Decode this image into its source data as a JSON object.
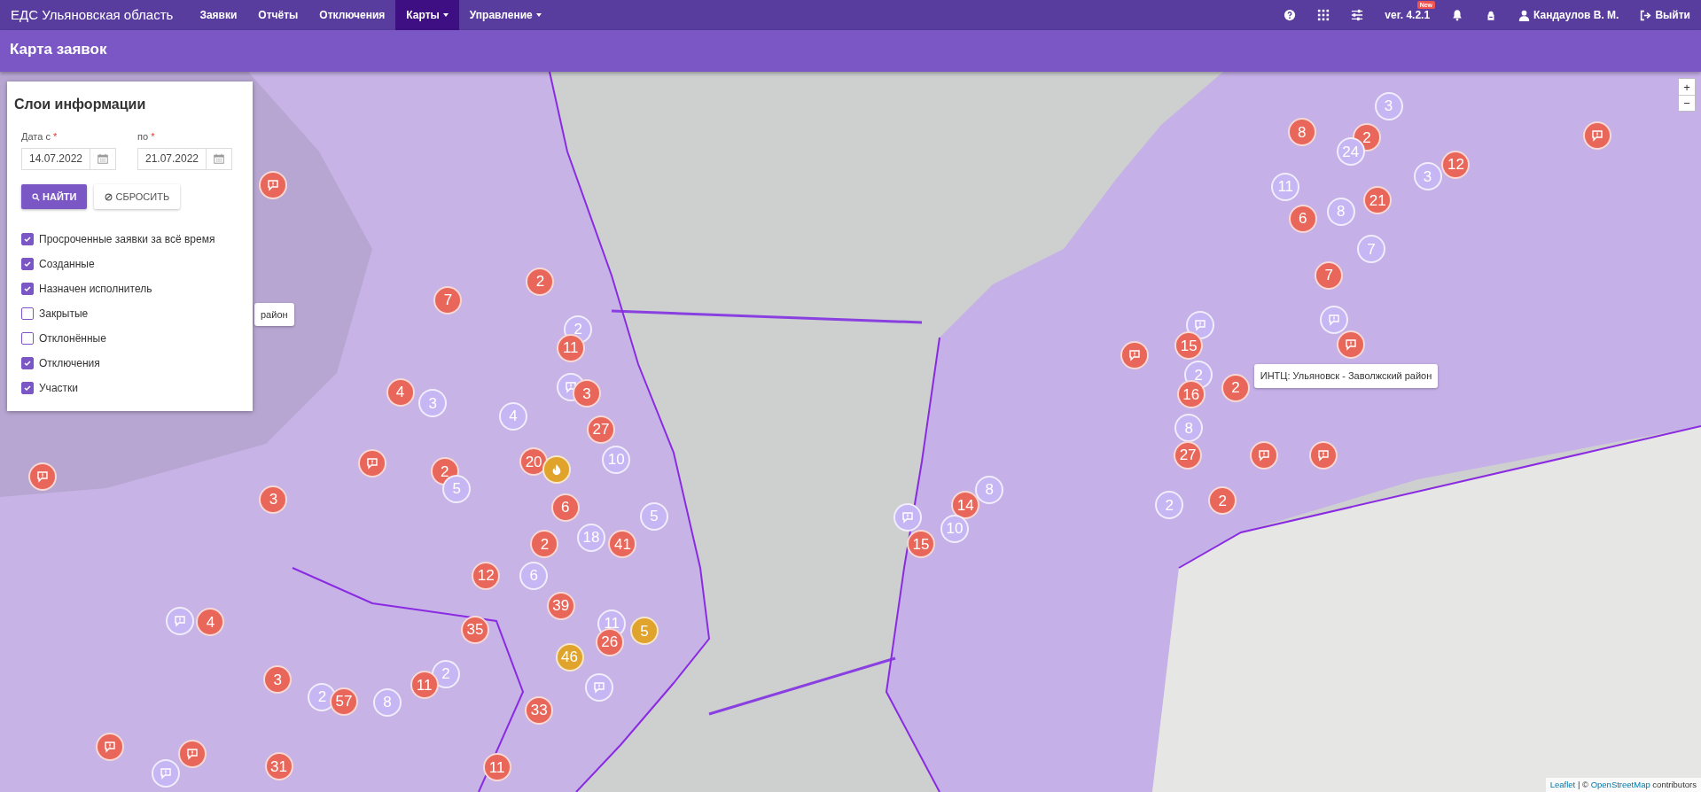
{
  "navbar": {
    "brand": "ЕДС Ульяновская область",
    "items": [
      {
        "label": "Заявки",
        "selected": false,
        "dropdown": false
      },
      {
        "label": "Отчёты",
        "selected": false,
        "dropdown": false
      },
      {
        "label": "Отключения",
        "selected": false,
        "dropdown": false
      },
      {
        "label": "Карты",
        "selected": true,
        "dropdown": true
      },
      {
        "label": "Управление",
        "selected": false,
        "dropdown": true
      }
    ],
    "version": "ver. 4.2.1",
    "version_badge": "New",
    "user": "Кандаулов В. М.",
    "logout": "Выйти"
  },
  "page_title": "Карта заявок",
  "layers_panel": {
    "title": "Слои информации",
    "date_fields": [
      {
        "label": "Дата с",
        "required_mark": "*",
        "value": "14.07.2022"
      },
      {
        "label": "по",
        "required_mark": "*",
        "value": "21.07.2022"
      }
    ],
    "buttons": [
      {
        "label": "НАЙТИ",
        "kind": "search"
      },
      {
        "label": "СБРОСИТЬ",
        "kind": "reset"
      }
    ],
    "layers": [
      {
        "label": "Просроченные заявки за всё время",
        "checked": true
      },
      {
        "label": "Созданные",
        "checked": true
      },
      {
        "label": "Назначен исполнитель",
        "checked": true
      },
      {
        "label": "Закрытые",
        "checked": false
      },
      {
        "label": "Отклонённые",
        "checked": false
      },
      {
        "label": "Отключения",
        "checked": true
      },
      {
        "label": "Участки",
        "checked": true
      }
    ]
  },
  "map": {
    "zoom_buttons": [
      "+",
      "−"
    ],
    "tooltips": [
      "район",
      "ИНТЦ: Ульяновск - Заволжский район"
    ],
    "markers": [
      {
        "kind": "red-note"
      },
      {
        "kind": "red",
        "label": "7"
      },
      {
        "kind": "red",
        "label": "2"
      },
      {
        "kind": "lilac",
        "label": "2"
      },
      {
        "kind": "red",
        "label": "11"
      },
      {
        "kind": "red",
        "label": "4"
      },
      {
        "kind": "lilac",
        "label": "3"
      },
      {
        "kind": "lilac",
        "label": "4"
      },
      {
        "kind": "lilac-note"
      },
      {
        "kind": "red",
        "label": "3"
      },
      {
        "kind": "red",
        "label": "27"
      },
      {
        "kind": "red-note"
      },
      {
        "kind": "red-note"
      },
      {
        "kind": "red",
        "label": "2"
      },
      {
        "kind": "lilac",
        "label": "5"
      },
      {
        "kind": "red",
        "label": "20"
      },
      {
        "kind": "fire"
      },
      {
        "kind": "lilac",
        "label": "10"
      },
      {
        "kind": "red",
        "label": "3"
      },
      {
        "kind": "lilac",
        "label": "5"
      },
      {
        "kind": "red",
        "label": "6"
      },
      {
        "kind": "red",
        "label": "2"
      },
      {
        "kind": "lilac",
        "label": "18"
      },
      {
        "kind": "red",
        "label": "41"
      },
      {
        "kind": "red",
        "label": "12"
      },
      {
        "kind": "lilac",
        "label": "6"
      },
      {
        "kind": "red",
        "label": "39"
      },
      {
        "kind": "lilac-note"
      },
      {
        "kind": "red",
        "label": "4"
      },
      {
        "kind": "red",
        "label": "35"
      },
      {
        "kind": "lilac",
        "label": "11"
      },
      {
        "kind": "orange",
        "label": "5"
      },
      {
        "kind": "red",
        "label": "26"
      },
      {
        "kind": "orange",
        "label": "46"
      },
      {
        "kind": "lilac",
        "label": "2"
      },
      {
        "kind": "red",
        "label": "3"
      },
      {
        "kind": "lilac",
        "label": "2"
      },
      {
        "kind": "red",
        "label": "57"
      },
      {
        "kind": "lilac",
        "label": "8"
      },
      {
        "kind": "red",
        "label": "11"
      },
      {
        "kind": "red",
        "label": "33"
      },
      {
        "kind": "lilac-note"
      },
      {
        "kind": "red-note"
      },
      {
        "kind": "red-note"
      },
      {
        "kind": "lilac-note"
      },
      {
        "kind": "red",
        "label": "31"
      },
      {
        "kind": "red",
        "label": "11"
      },
      {
        "kind": "lilac",
        "label": "3"
      },
      {
        "kind": "red",
        "label": "8"
      },
      {
        "kind": "red",
        "label": "2"
      },
      {
        "kind": "lilac",
        "label": "24"
      },
      {
        "kind": "red-note"
      },
      {
        "kind": "red",
        "label": "12"
      },
      {
        "kind": "lilac",
        "label": "3"
      },
      {
        "kind": "lilac",
        "label": "11"
      },
      {
        "kind": "red",
        "label": "21"
      },
      {
        "kind": "lilac",
        "label": "8"
      },
      {
        "kind": "red",
        "label": "6"
      },
      {
        "kind": "lilac",
        "label": "7"
      },
      {
        "kind": "red",
        "label": "7"
      },
      {
        "kind": "lilac-note"
      },
      {
        "kind": "lilac-note"
      },
      {
        "kind": "red-note"
      },
      {
        "kind": "red",
        "label": "15"
      },
      {
        "kind": "red-note"
      },
      {
        "kind": "lilac",
        "label": "2"
      },
      {
        "kind": "red",
        "label": "16"
      },
      {
        "kind": "red",
        "label": "2"
      },
      {
        "kind": "lilac",
        "label": "8"
      },
      {
        "kind": "red",
        "label": "27"
      },
      {
        "kind": "red-note"
      },
      {
        "kind": "red-note"
      },
      {
        "kind": "lilac",
        "label": "2"
      },
      {
        "kind": "red",
        "label": "2"
      },
      {
        "kind": "lilac",
        "label": "8"
      },
      {
        "kind": "red",
        "label": "14"
      },
      {
        "kind": "lilac-note"
      },
      {
        "kind": "lilac",
        "label": "10"
      },
      {
        "kind": "red",
        "label": "15"
      }
    ],
    "attribution": {
      "link_1": "Leaflet",
      "separator": "|",
      "copyright": "©",
      "link_2": "OpenStreetMap",
      "suffix": "contributors"
    }
  }
}
